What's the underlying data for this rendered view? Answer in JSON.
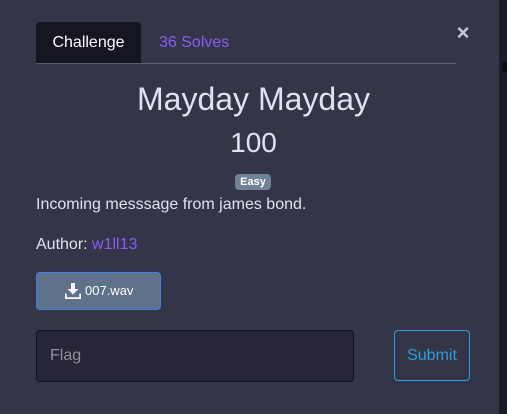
{
  "modal": {
    "close_symbol": "×",
    "close_icon": "close-icon"
  },
  "tabs": [
    {
      "label": "Challenge",
      "active": true
    },
    {
      "label": "36 Solves",
      "active": false
    }
  ],
  "challenge": {
    "name": "Mayday Mayday",
    "points": "100",
    "difficulty": "Easy",
    "description": "Incoming messsage from james bond.",
    "author_label": "Author:",
    "author_name": "w1ll13"
  },
  "files": [
    {
      "name": "007.wav",
      "icon": "download-icon"
    }
  ],
  "flag_form": {
    "placeholder": "Flag",
    "value": "",
    "submit_label": "Submit"
  },
  "colors": {
    "background": "#353549",
    "accent_purple": "#8a5cf5",
    "submit_blue": "#2aa1d8",
    "badge": "#6f8296",
    "file_button": "#5f728a"
  }
}
